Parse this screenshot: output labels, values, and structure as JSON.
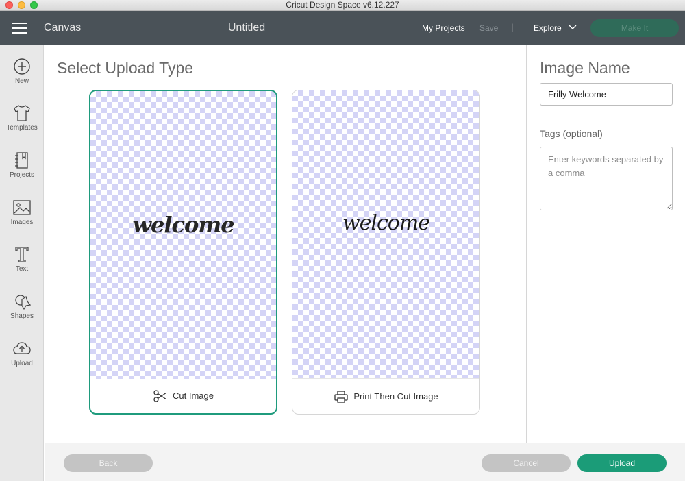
{
  "window": {
    "title": "Cricut Design Space  v6.12.227"
  },
  "header": {
    "canvas_label": "Canvas",
    "document_title": "Untitled",
    "my_projects": "My Projects",
    "save": "Save",
    "separator": "|",
    "explore": "Explore",
    "make_it": "Make It"
  },
  "sidebar": {
    "items": [
      {
        "label": "New",
        "icon": "plus-circle-icon"
      },
      {
        "label": "Templates",
        "icon": "shirt-icon"
      },
      {
        "label": "Projects",
        "icon": "notebook-icon"
      },
      {
        "label": "Images",
        "icon": "image-icon"
      },
      {
        "label": "Text",
        "icon": "text-icon"
      },
      {
        "label": "Shapes",
        "icon": "shapes-icon"
      },
      {
        "label": "Upload",
        "icon": "cloud-upload-icon"
      }
    ]
  },
  "main": {
    "title": "Select Upload Type",
    "cards": [
      {
        "artwork_text": "welcome",
        "label": "Cut Image",
        "icon": "scissors-icon",
        "selected": true
      },
      {
        "artwork_text": "welcome",
        "label": "Print Then Cut Image",
        "icon": "printer-icon",
        "selected": false
      }
    ]
  },
  "right_panel": {
    "image_name_title": "Image Name",
    "image_name_value": "Frilly Welcome",
    "tags_label": "Tags (optional)",
    "tags_placeholder": "Enter keywords separated by a comma"
  },
  "footer": {
    "back": "Back",
    "cancel": "Cancel",
    "upload": "Upload"
  },
  "colors": {
    "accent": "#1b9c78",
    "header_bg": "#4a5258",
    "checker": "#d4d4f6"
  }
}
